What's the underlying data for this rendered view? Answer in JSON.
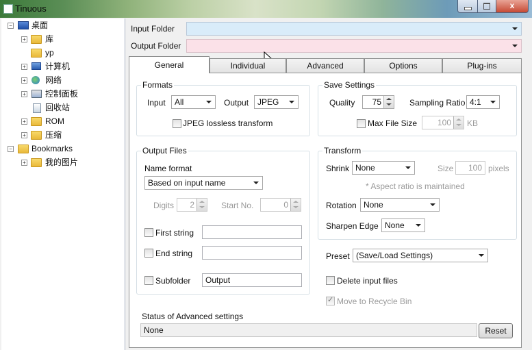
{
  "window": {
    "title": "Tinuous",
    "close_glyph": "x"
  },
  "tree": {
    "items": [
      {
        "label": "桌面",
        "icon": "desktop-icon"
      },
      {
        "label": "库",
        "icon": "folder-icon"
      },
      {
        "label": "yp",
        "icon": "folder-icon"
      },
      {
        "label": "计算机",
        "icon": "computer-icon"
      },
      {
        "label": "网络",
        "icon": "network-icon"
      },
      {
        "label": "控制面板",
        "icon": "control-panel-icon"
      },
      {
        "label": "回收站",
        "icon": "recycle-bin-icon"
      },
      {
        "label": "ROM",
        "icon": "folder-icon"
      },
      {
        "label": "压缩",
        "icon": "folder-icon"
      },
      {
        "label": "Bookmarks",
        "icon": "folder-icon"
      },
      {
        "label": "我的图片",
        "icon": "folder-icon"
      }
    ],
    "expand_glyph": "+",
    "collapse_glyph": "−"
  },
  "input_folder": {
    "label": "Input Folder",
    "value": "",
    "color": "#d9ecf9"
  },
  "output_folder": {
    "label": "Output Folder",
    "value": "",
    "color": "#fbe1e8"
  },
  "tabs": [
    "General",
    "Individual",
    "Advanced",
    "Options",
    "Plug-ins"
  ],
  "formats": {
    "title": "Formats",
    "input_label": "Input",
    "input_value": "All",
    "output_label": "Output",
    "output_value": "JPEG",
    "lossless_label": "JPEG lossless transform"
  },
  "save_settings": {
    "title": "Save Settings",
    "quality_label": "Quality",
    "quality_value": "75",
    "sampling_label": "Sampling Ratio",
    "sampling_value": "4:1",
    "max_file_size_label": "Max File Size",
    "max_file_size_value": "100",
    "max_file_size_unit": "KB"
  },
  "output_files": {
    "title": "Output Files",
    "name_format_label": "Name format",
    "name_format_value": "Based on input name",
    "digits_label": "Digits",
    "digits_value": "2",
    "start_no_label": "Start No.",
    "start_no_value": "0",
    "first_string_label": "First string",
    "first_string_value": "",
    "end_string_label": "End string",
    "end_string_value": "",
    "subfolder_label": "Subfolder",
    "subfolder_value": "Output"
  },
  "transform": {
    "title": "Transform",
    "shrink_label": "Shrink",
    "shrink_value": "None",
    "size_label": "Size",
    "size_value": "100",
    "size_unit": "pixels",
    "aspect_note": "* Aspect ratio is maintained",
    "rotation_label": "Rotation",
    "rotation_value": "None",
    "sharpen_label": "Sharpen Edge",
    "sharpen_value": "None"
  },
  "preset": {
    "label": "Preset",
    "value": "(Save/Load Settings)"
  },
  "delete_input_label": "Delete input files",
  "move_recycle_label": "Move to Recycle Bin",
  "status": {
    "label": "Status of Advanced settings",
    "value": "None",
    "reset_label": "Reset"
  }
}
